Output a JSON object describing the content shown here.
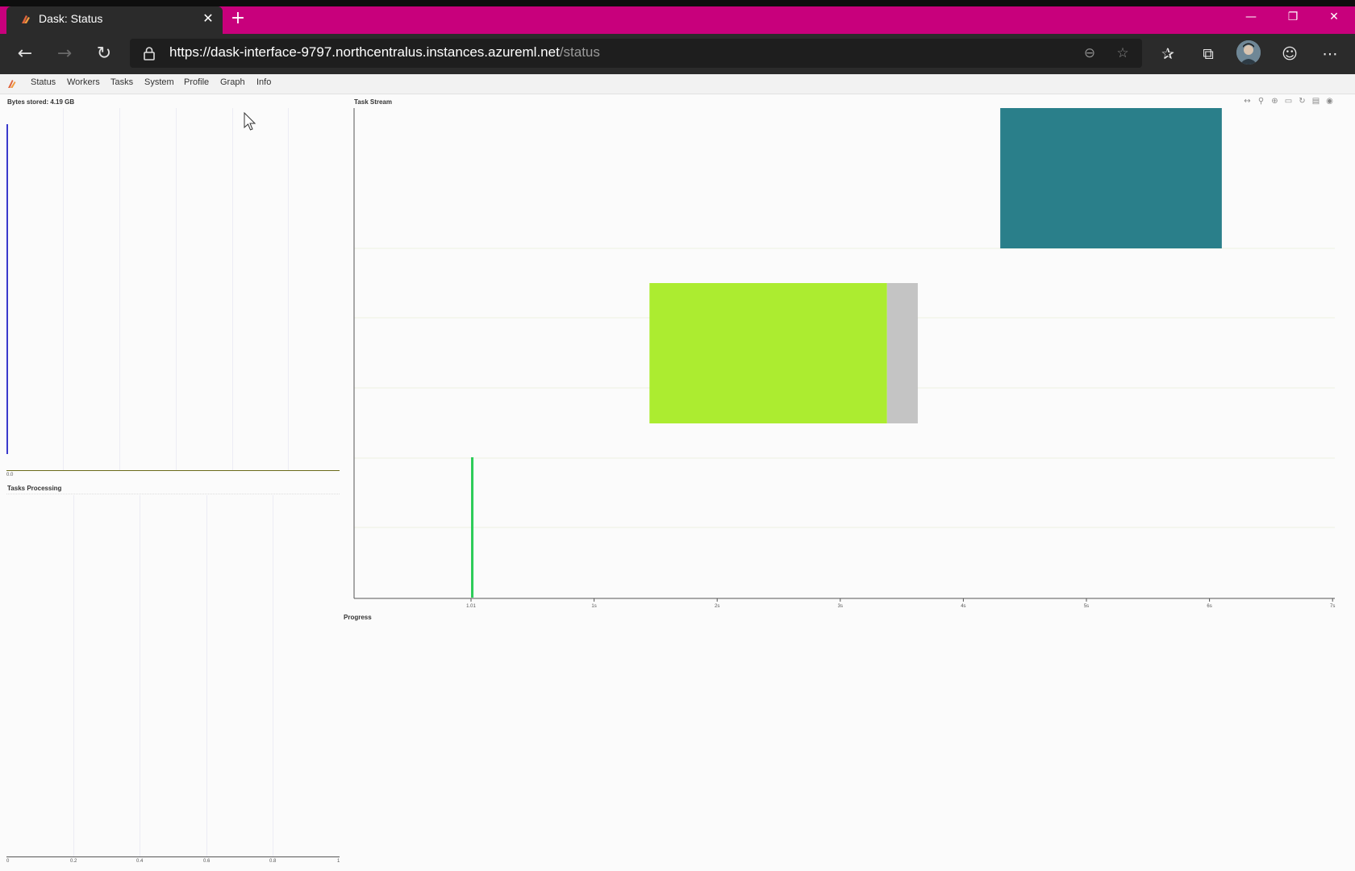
{
  "browser": {
    "tab_title": "Dask: Status",
    "url_host": "https://dask-interface-9797.northcentralus.instances.azureml.net",
    "url_path": "/status",
    "accent_color": "#c8007c",
    "icons": [
      "back-icon",
      "forward-icon",
      "refresh-icon",
      "lock-icon",
      "zoom-out-icon",
      "star-icon",
      "favorites-icon",
      "collections-icon",
      "profile-avatar",
      "feedback-icon",
      "more-icon"
    ]
  },
  "nav": {
    "items": [
      "Status",
      "Workers",
      "Tasks",
      "System",
      "Profile",
      "Graph",
      "Info"
    ]
  },
  "bytes_stored": {
    "title": "Bytes stored: 4.19 GB",
    "x_tick": "0.0"
  },
  "tasks_processing": {
    "title": "Tasks Processing",
    "x_ticks": [
      "0",
      "0.2",
      "0.4",
      "0.6",
      "0.8",
      "1"
    ]
  },
  "task_stream": {
    "title": "Task Stream",
    "x_ticks": [
      "1.01",
      "1s",
      "2s",
      "3s",
      "4s",
      "5s",
      "6s",
      "7s"
    ]
  },
  "progress": {
    "title": "Progress"
  },
  "chart_data": {
    "type": "bar",
    "title": "Task Stream",
    "xlabel": "",
    "ylabel": "",
    "xlim": [
      0,
      7
    ],
    "series": [
      {
        "row": 0,
        "start": 0.0,
        "end": 0.02,
        "color": "#2ecc5a"
      },
      {
        "row": 1,
        "start": 1.45,
        "end": 3.38,
        "color": "#acec30"
      },
      {
        "row": 1,
        "start": 3.38,
        "end": 3.63,
        "color": "#c4c4c4"
      },
      {
        "row": 2,
        "start": 4.3,
        "end": 6.1,
        "color": "#2a7f8a"
      }
    ]
  }
}
